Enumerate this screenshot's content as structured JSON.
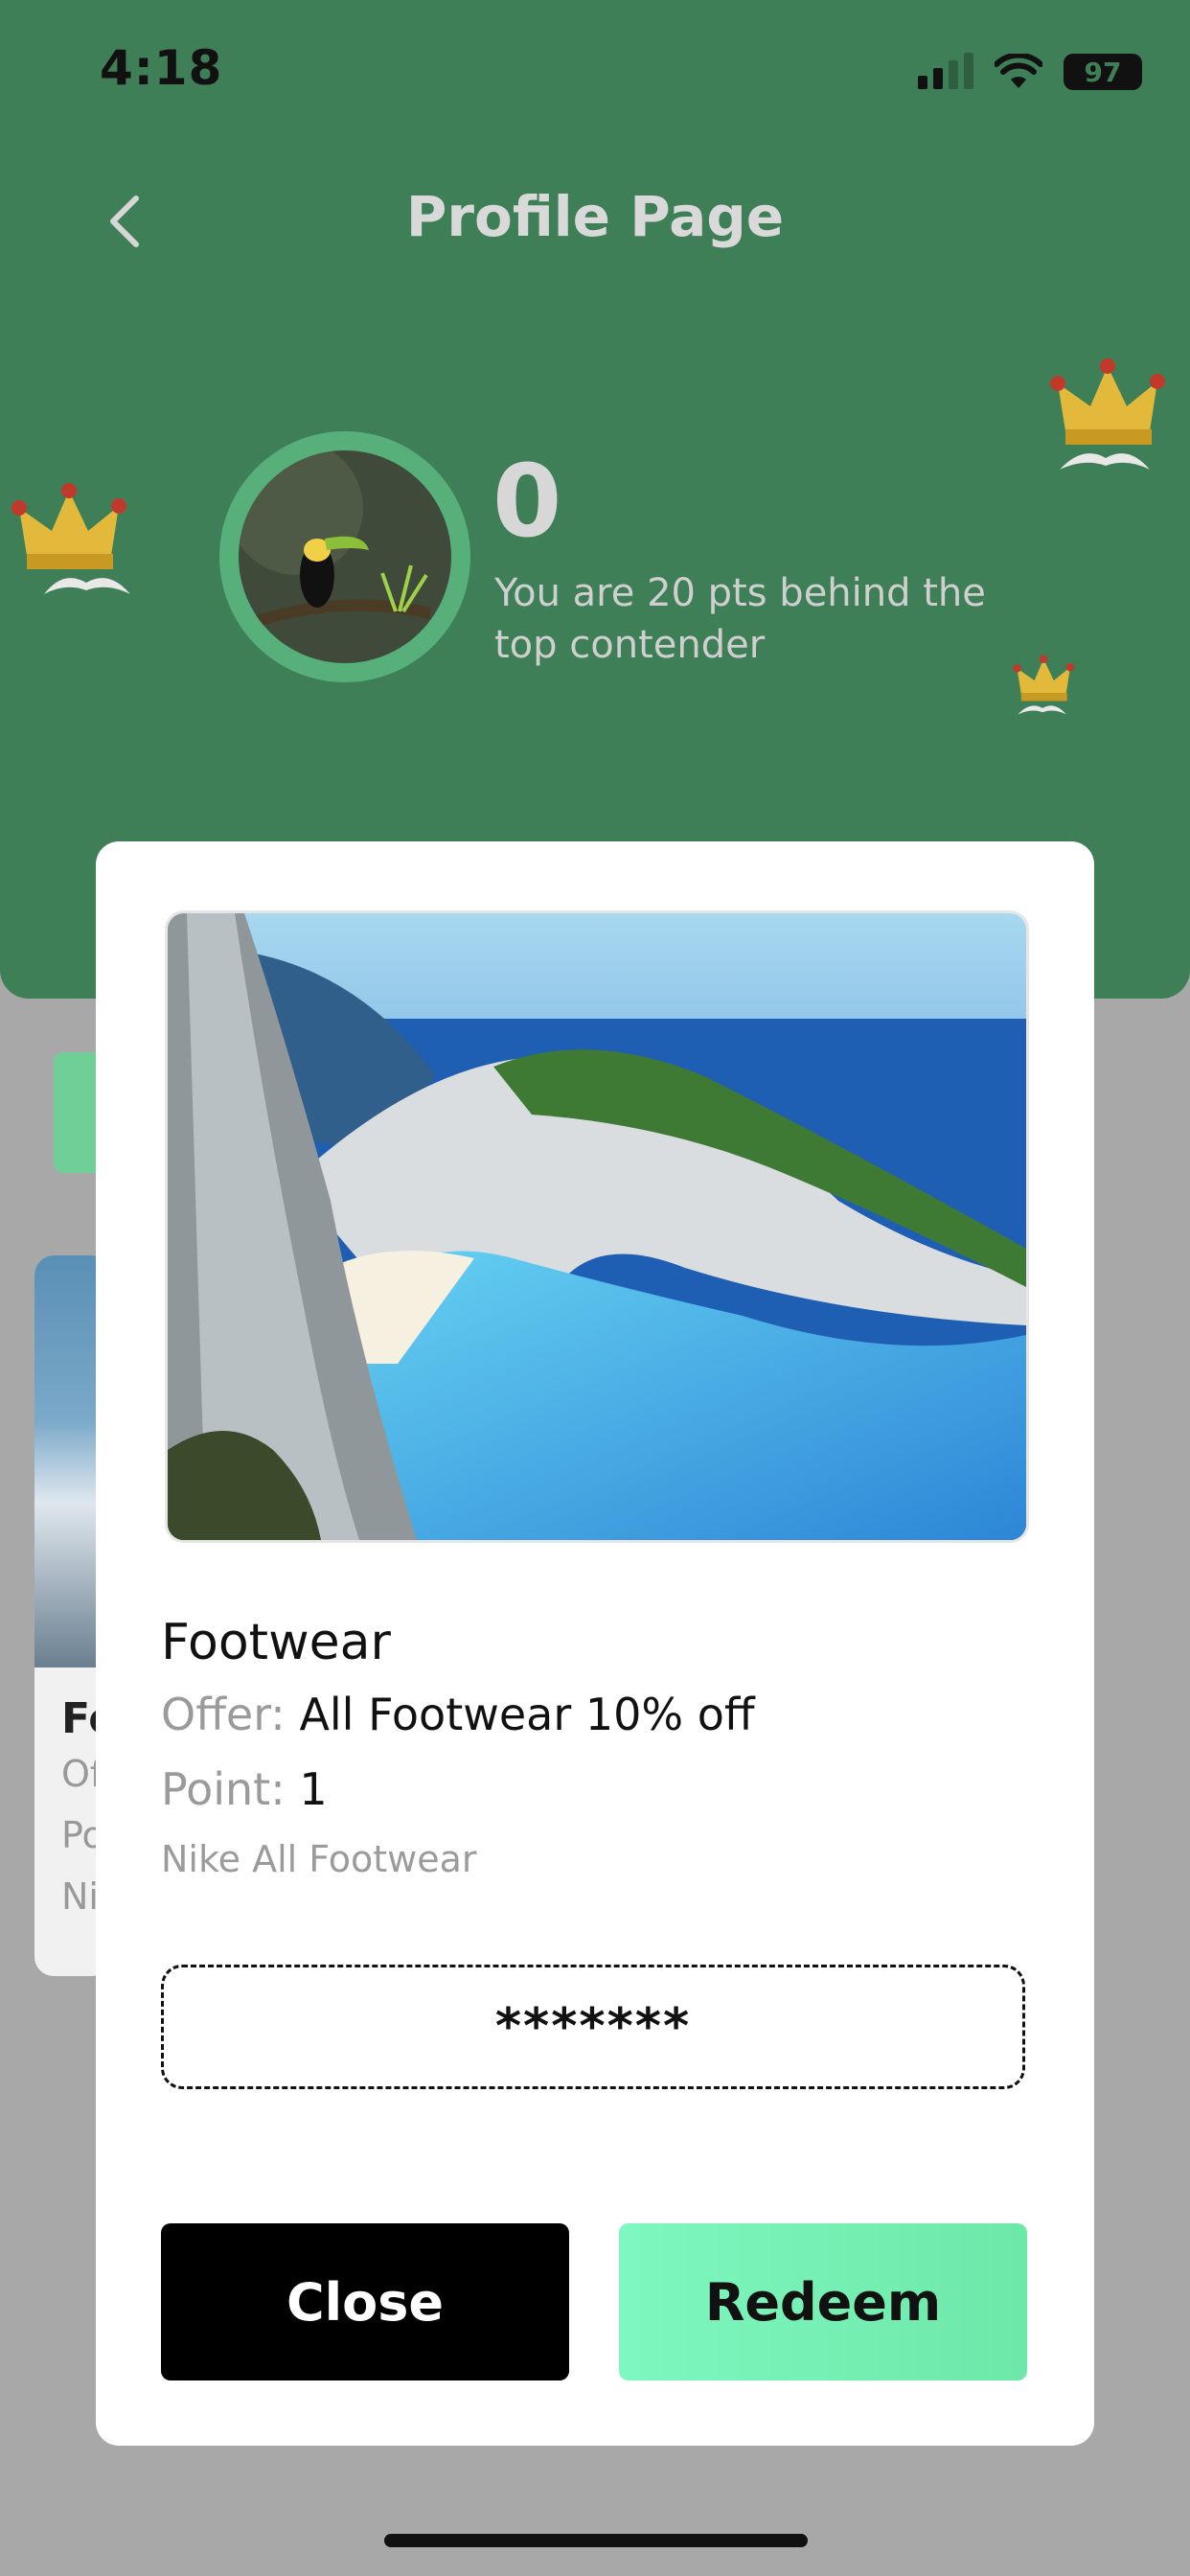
{
  "status_bar": {
    "time": "4:18",
    "battery": "97",
    "icons": [
      "signal-icon",
      "wifi-icon",
      "battery-icon"
    ]
  },
  "header": {
    "title": "Profile Page",
    "back_icon": "chevron-left-icon"
  },
  "profile": {
    "score": "0",
    "behind_text": "You are 20 pts behind the top contender"
  },
  "modal": {
    "title": "Footwear",
    "offer_label": "Offer:",
    "offer_value": "All Footwear 10% off",
    "point_label": "Point:",
    "point_value": "1",
    "description": "Nike All Footwear",
    "code": "*******",
    "close_label": "Close",
    "redeem_label": "Redeem"
  },
  "background_card": {
    "title": "Fo",
    "line1": "Of",
    "line2": "Po",
    "line3": "Ni"
  },
  "colors": {
    "header_bg": "#3e7f57",
    "overlay": "#a8a8a8",
    "accent_green": "#7ef7c0",
    "avatar_ring": "#57b07a"
  }
}
